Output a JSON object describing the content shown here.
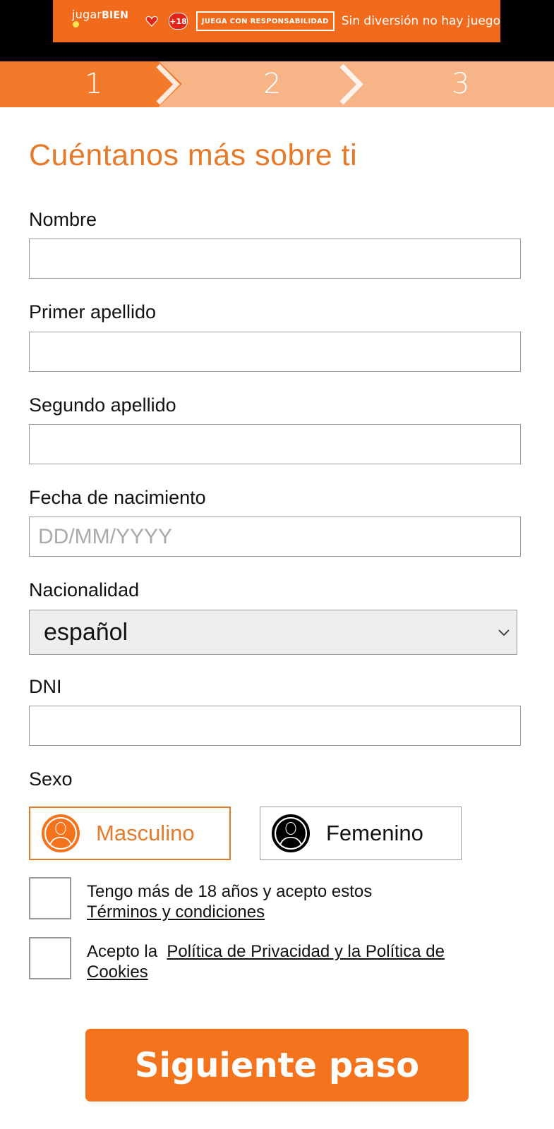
{
  "banner": {
    "logo_text_light": "jugar",
    "logo_text_bold": "BIEN",
    "age_badge": "+18",
    "responsible_label": "JUEGA CON RESPONSABILIDAD",
    "slogan": "Sin diversión no hay juego"
  },
  "steps": {
    "items": [
      "1",
      "2",
      "3"
    ],
    "active_index": 0
  },
  "form": {
    "title": "Cuéntanos más sobre ti",
    "nombre_label": "Nombre",
    "nombre_value": "",
    "primer_apellido_label": "Primer apellido",
    "primer_apellido_value": "",
    "segundo_apellido_label": "Segundo apellido",
    "segundo_apellido_value": "",
    "fecha_label": "Fecha de nacimiento",
    "fecha_placeholder": "DD/MM/YYYY",
    "nacionalidad_label": "Nacionalidad",
    "nacionalidad_value": "español",
    "dni_label": "DNI",
    "dni_value": "",
    "sexo_label": "Sexo",
    "sexo_options": [
      "Masculino",
      "Femenino"
    ],
    "sexo_selected": "Masculino",
    "terms_text": "Tengo más de 18 años y acepto estos",
    "terms_link": "Términos y condiciones",
    "terms_checked": false,
    "privacy_text": "Acepto la",
    "privacy_link": "Política de Privacidad y la Política de Cookies",
    "privacy_checked": false,
    "next_button": "Siguiente paso"
  },
  "colors": {
    "accent": "#f5731c",
    "title": "#e67a2a",
    "steps_inactive": "#f7b487"
  }
}
